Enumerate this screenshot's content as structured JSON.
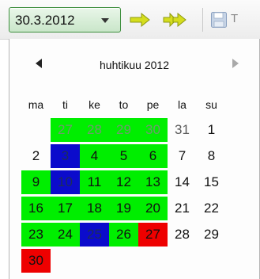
{
  "toolbar": {
    "date_value": "30.3.2012",
    "partial_button_text": "T"
  },
  "calendar": {
    "month_title": "huhtikuu 2012",
    "weekdays": [
      "ma",
      "ti",
      "ke",
      "to",
      "pe",
      "la",
      "su"
    ],
    "days": [
      {
        "label": "27",
        "row": 0,
        "col": 1,
        "status": "green",
        "outside_month": true
      },
      {
        "label": "28",
        "row": 0,
        "col": 2,
        "status": "green",
        "outside_month": true
      },
      {
        "label": "29",
        "row": 0,
        "col": 3,
        "status": "green",
        "outside_month": true
      },
      {
        "label": "30",
        "row": 0,
        "col": 4,
        "status": "green",
        "outside_month": true
      },
      {
        "label": "31",
        "row": 0,
        "col": 5,
        "status": "none",
        "outside_month": true
      },
      {
        "label": "1",
        "row": 0,
        "col": 6,
        "status": "none",
        "outside_month": false
      },
      {
        "label": "2",
        "row": 1,
        "col": 0,
        "status": "none",
        "outside_month": false
      },
      {
        "label": "3",
        "row": 1,
        "col": 1,
        "status": "blue",
        "outside_month": false
      },
      {
        "label": "4",
        "row": 1,
        "col": 2,
        "status": "green",
        "outside_month": false
      },
      {
        "label": "5",
        "row": 1,
        "col": 3,
        "status": "green",
        "outside_month": false
      },
      {
        "label": "6",
        "row": 1,
        "col": 4,
        "status": "green",
        "outside_month": false
      },
      {
        "label": "7",
        "row": 1,
        "col": 5,
        "status": "none",
        "outside_month": false
      },
      {
        "label": "8",
        "row": 1,
        "col": 6,
        "status": "none",
        "outside_month": false
      },
      {
        "label": "9",
        "row": 2,
        "col": 0,
        "status": "green",
        "outside_month": false
      },
      {
        "label": "10",
        "row": 2,
        "col": 1,
        "status": "blue",
        "outside_month": false
      },
      {
        "label": "11",
        "row": 2,
        "col": 2,
        "status": "green",
        "outside_month": false
      },
      {
        "label": "12",
        "row": 2,
        "col": 3,
        "status": "green",
        "outside_month": false
      },
      {
        "label": "13",
        "row": 2,
        "col": 4,
        "status": "green",
        "outside_month": false
      },
      {
        "label": "14",
        "row": 2,
        "col": 5,
        "status": "none",
        "outside_month": false
      },
      {
        "label": "15",
        "row": 2,
        "col": 6,
        "status": "none",
        "outside_month": false
      },
      {
        "label": "16",
        "row": 3,
        "col": 0,
        "status": "green",
        "outside_month": false
      },
      {
        "label": "17",
        "row": 3,
        "col": 1,
        "status": "green",
        "outside_month": false
      },
      {
        "label": "18",
        "row": 3,
        "col": 2,
        "status": "green",
        "outside_month": false
      },
      {
        "label": "19",
        "row": 3,
        "col": 3,
        "status": "green",
        "outside_month": false
      },
      {
        "label": "20",
        "row": 3,
        "col": 4,
        "status": "green",
        "outside_month": false
      },
      {
        "label": "21",
        "row": 3,
        "col": 5,
        "status": "none",
        "outside_month": false
      },
      {
        "label": "22",
        "row": 3,
        "col": 6,
        "status": "none",
        "outside_month": false
      },
      {
        "label": "23",
        "row": 4,
        "col": 0,
        "status": "green",
        "outside_month": false
      },
      {
        "label": "24",
        "row": 4,
        "col": 1,
        "status": "green",
        "outside_month": false
      },
      {
        "label": "25",
        "row": 4,
        "col": 2,
        "status": "blue",
        "outside_month": false
      },
      {
        "label": "26",
        "row": 4,
        "col": 3,
        "status": "green",
        "outside_month": false
      },
      {
        "label": "27",
        "row": 4,
        "col": 4,
        "status": "red",
        "outside_month": false
      },
      {
        "label": "28",
        "row": 4,
        "col": 5,
        "status": "none",
        "outside_month": false
      },
      {
        "label": "29",
        "row": 4,
        "col": 6,
        "status": "none",
        "outside_month": false
      },
      {
        "label": "30",
        "row": 5,
        "col": 0,
        "status": "red",
        "outside_month": false
      }
    ]
  },
  "colors": {
    "status_green": "#00ee00",
    "status_blue": "#0b0bcc",
    "status_red": "#ee0000",
    "dropdown_border": "#3f8f3f"
  },
  "icons": [
    "dropdown-arrow-icon",
    "next-arrow-icon",
    "double-next-arrow-icon",
    "save-icon",
    "prev-month-icon",
    "next-month-icon"
  ]
}
